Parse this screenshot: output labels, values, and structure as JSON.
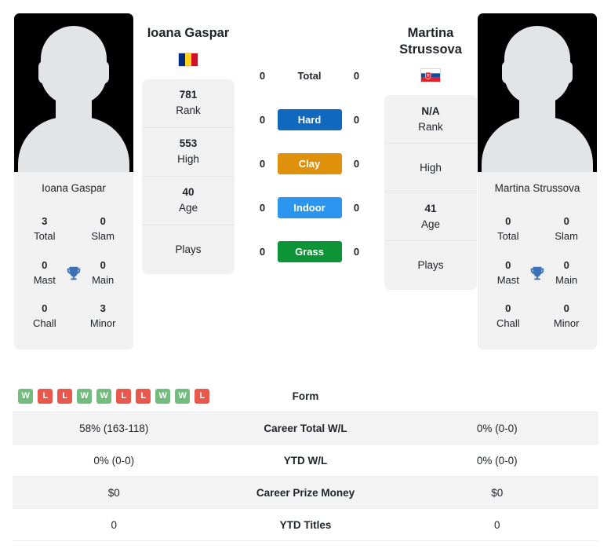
{
  "players": {
    "left": {
      "name": "Ioana Gaspar",
      "photo_caption": "Ioana Gaspar",
      "flag": "romania-flag",
      "titles": [
        {
          "value": "3",
          "label": "Total"
        },
        {
          "value": "0",
          "label": "Slam"
        },
        {
          "value": "0",
          "label": "Mast"
        },
        {
          "value": "0",
          "label": "Main"
        },
        {
          "value": "0",
          "label": "Chall"
        },
        {
          "value": "3",
          "label": "Minor"
        }
      ],
      "vstats": [
        {
          "value": "781",
          "label": "Rank"
        },
        {
          "value": "553",
          "label": "High"
        },
        {
          "value": "40",
          "label": "Age"
        },
        {
          "value": "",
          "label": "Plays"
        }
      ]
    },
    "right": {
      "name_line1": "Martina",
      "name_line2": "Strussova",
      "photo_caption": "Martina Strussova",
      "flag": "slovakia-flag",
      "titles": [
        {
          "value": "0",
          "label": "Total"
        },
        {
          "value": "0",
          "label": "Slam"
        },
        {
          "value": "0",
          "label": "Mast"
        },
        {
          "value": "0",
          "label": "Main"
        },
        {
          "value": "0",
          "label": "Chall"
        },
        {
          "value": "0",
          "label": "Minor"
        }
      ],
      "vstats": [
        {
          "value": "N/A",
          "label": "Rank"
        },
        {
          "value": "",
          "label": "High"
        },
        {
          "value": "41",
          "label": "Age"
        },
        {
          "value": "",
          "label": "Plays"
        }
      ]
    }
  },
  "surfaces": [
    {
      "label": "Total",
      "left": "0",
      "right": "0",
      "color": "",
      "badge": false
    },
    {
      "label": "Hard",
      "left": "0",
      "right": "0",
      "color": "#1068bf",
      "badge": true
    },
    {
      "label": "Clay",
      "left": "0",
      "right": "0",
      "color": "#e0910b",
      "badge": true
    },
    {
      "label": "Indoor",
      "left": "0",
      "right": "0",
      "color": "#2b95f0",
      "badge": true
    },
    {
      "label": "Grass",
      "left": "0",
      "right": "0",
      "color": "#0d9436",
      "badge": true
    }
  ],
  "table": {
    "form_label": "Form",
    "form_left": [
      "W",
      "L",
      "L",
      "W",
      "W",
      "L",
      "L",
      "W",
      "W",
      "L"
    ],
    "form_right": [],
    "rows": [
      {
        "left": "58% (163-118)",
        "label": "Career Total W/L",
        "right": "0% (0-0)"
      },
      {
        "left": "0% (0-0)",
        "label": "YTD W/L",
        "right": "0% (0-0)"
      },
      {
        "left": "$0",
        "label": "Career Prize Money",
        "right": "$0"
      },
      {
        "left": "0",
        "label": "YTD Titles",
        "right": "0"
      }
    ]
  },
  "colors": {
    "win": "#72bc7e",
    "loss": "#e8584c",
    "trophy": "#3b72b5"
  }
}
